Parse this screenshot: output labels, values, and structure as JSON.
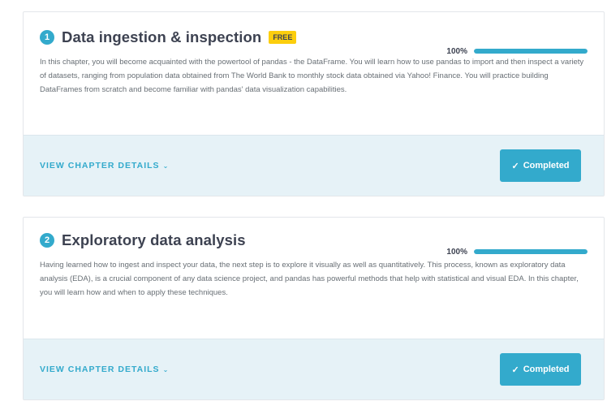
{
  "colors": {
    "accent": "#33aacc",
    "free_badge": "#fcce0d",
    "footer_bg": "#e6f2f7",
    "title_text": "#3d4251",
    "body_text": "#686f75"
  },
  "chapters": [
    {
      "number": "1",
      "title": "Data ingestion & inspection",
      "badge": "FREE",
      "progress_label": "100%",
      "progress_fraction": 1.0,
      "description": "In this chapter, you will become acquainted with the powertool of pandas - the DataFrame. You will learn how to use pandas to import and then inspect a variety of datasets, ranging from population data obtained from The World Bank to monthly stock data obtained via Yahoo! Finance. You will practice building DataFrames from scratch and become familiar with pandas' data visualization capabilities.",
      "details_label": "VIEW CHAPTER DETAILS",
      "details_icon": "chevron-down-icon",
      "button_label": "Completed",
      "button_icon": "check-icon"
    },
    {
      "number": "2",
      "title": "Exploratory data analysis",
      "progress_label": "100%",
      "progress_fraction": 1.0,
      "description": "Having learned how to ingest and inspect your data, the next step is to explore it visually as well as quantitatively. This process, known as exploratory data analysis (EDA), is a crucial component of any data science project, and pandas has powerful methods that help with statistical and visual EDA. In this chapter, you will learn how and when to apply these techniques.",
      "details_label": "VIEW CHAPTER DETAILS",
      "details_icon": "chevron-down-icon",
      "button_label": "Completed",
      "button_icon": "check-icon"
    }
  ]
}
